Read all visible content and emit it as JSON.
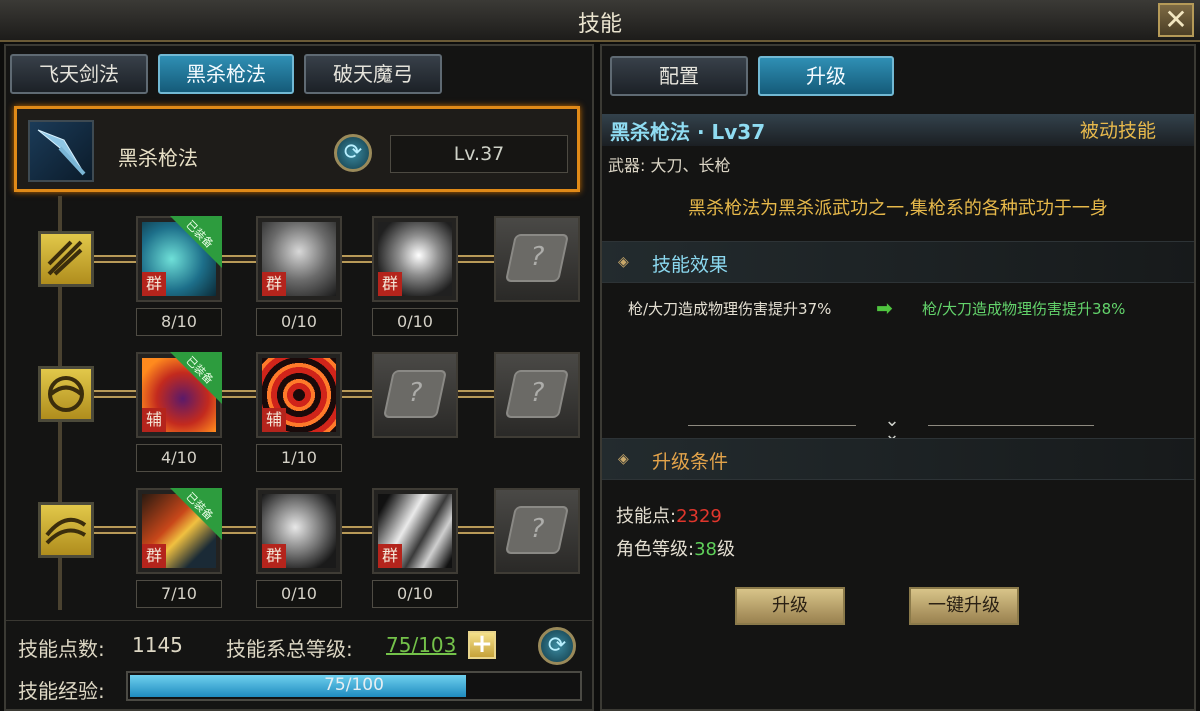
{
  "window": {
    "title": "技能",
    "close_label": "✕"
  },
  "left": {
    "tabs": [
      {
        "label": "飞天剑法",
        "active": false
      },
      {
        "label": "黑杀枪法",
        "active": true
      },
      {
        "label": "破天魔弓",
        "active": false
      }
    ],
    "header": {
      "name": "黑杀枪法",
      "level": "Lv.37"
    },
    "rows": [
      {
        "skills": [
          {
            "tag": "群",
            "equipped": true,
            "count": "8/10",
            "locked": false
          },
          {
            "tag": "群",
            "equipped": false,
            "count": "0/10",
            "locked": false
          },
          {
            "tag": "群",
            "equipped": false,
            "count": "0/10",
            "locked": false
          },
          {
            "locked": true
          }
        ]
      },
      {
        "skills": [
          {
            "tag": "辅",
            "equipped": true,
            "count": "4/10",
            "locked": false
          },
          {
            "tag": "辅",
            "equipped": false,
            "count": "1/10",
            "locked": false
          },
          {
            "locked": true
          },
          {
            "locked": true
          }
        ]
      },
      {
        "skills": [
          {
            "tag": "群",
            "equipped": true,
            "count": "7/10",
            "locked": false
          },
          {
            "tag": "群",
            "equipped": false,
            "count": "0/10",
            "locked": false
          },
          {
            "tag": "群",
            "equipped": false,
            "count": "0/10",
            "locked": false
          },
          {
            "locked": true
          }
        ]
      }
    ],
    "equipped_label": "已装备",
    "footer": {
      "points_label": "技能点数:",
      "points_value": "1145",
      "total_level_label": "技能系总等级:",
      "total_level_value": "75/103",
      "plus_label": "+",
      "exp_label": "技能经验:",
      "exp_text": "75/100",
      "exp_fraction": 0.75
    }
  },
  "right": {
    "tabs": [
      {
        "label": "配置",
        "active": false
      },
      {
        "label": "升级",
        "active": true
      }
    ],
    "title": "黑杀枪法 · Lv37",
    "type": "被动技能",
    "weapon": "武器: 大刀、长枪",
    "description": "黑杀枪法为黑杀派武功之一,集枪系的各种武功于一身",
    "effect_section": "技能效果",
    "effect_before": "枪/大刀造成物理伤害提升37%",
    "effect_after": "枪/大刀造成物理伤害提升38%",
    "condition_section": "升级条件",
    "conditions": {
      "points_label": "技能点:",
      "points_value": "2329",
      "level_label": "角色等级:",
      "level_value": "38",
      "level_suffix": "级"
    },
    "buttons": {
      "upgrade": "升级",
      "upgrade_all": "一键升级"
    }
  },
  "colors": {
    "accent_orange": "#e08a18",
    "tab_active": "#2f8fb4",
    "green": "#63d36b",
    "red": "#e0362c",
    "gold": "#e6b84a"
  }
}
